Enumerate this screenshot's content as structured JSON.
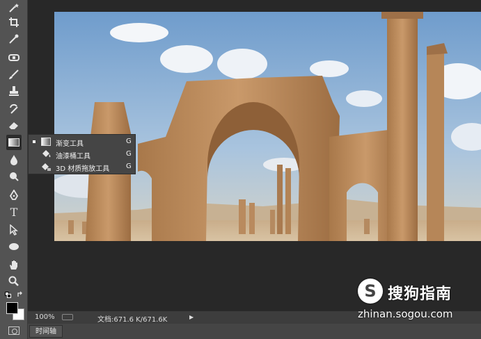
{
  "toolbar": {
    "tools": [
      {
        "name": "magic-wand-icon"
      },
      {
        "name": "crop-icon"
      },
      {
        "name": "eyedropper-icon"
      },
      {
        "name": "spot-healing-icon"
      },
      {
        "name": "brush-icon"
      },
      {
        "name": "clone-stamp-icon"
      },
      {
        "name": "history-brush-icon"
      },
      {
        "name": "eraser-icon"
      },
      {
        "name": "gradient-icon"
      },
      {
        "name": "blur-icon"
      },
      {
        "name": "dodge-icon"
      },
      {
        "name": "pen-icon"
      },
      {
        "name": "type-icon",
        "glyph": "T"
      },
      {
        "name": "path-selection-icon"
      },
      {
        "name": "ellipse-icon"
      },
      {
        "name": "hand-icon"
      },
      {
        "name": "zoom-icon"
      }
    ],
    "foreground_color": "#000000",
    "background_color": "#ffffff"
  },
  "flyout": {
    "items": [
      {
        "label": "渐变工具",
        "shortcut": "G",
        "selected": true,
        "icon": "gradient-icon"
      },
      {
        "label": "油漆桶工具",
        "shortcut": "G",
        "selected": false,
        "icon": "paint-bucket-icon"
      },
      {
        "label": "3D 材质拖放工具",
        "shortcut": "G",
        "selected": false,
        "icon": "material-drop-icon"
      }
    ]
  },
  "status": {
    "zoom": "100%",
    "doc_info": "文档:671.6 K/671.6K"
  },
  "timeline": {
    "tab_label": "时间轴"
  },
  "watermark": {
    "logo": "S",
    "name": "搜狗指南",
    "url": "zhinan.sogou.com"
  }
}
